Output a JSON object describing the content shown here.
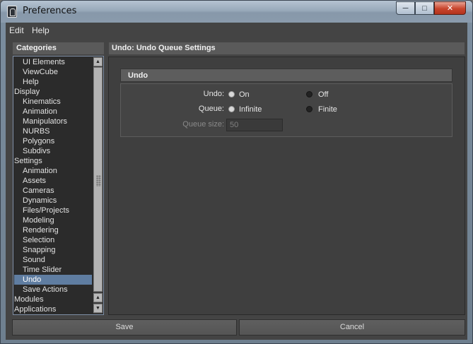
{
  "window": {
    "title": "Preferences",
    "icon": "maya-app-icon",
    "controls": {
      "minimize": "minimize-icon",
      "maximize": "maximize-icon",
      "close": "close-icon"
    }
  },
  "menubar": [
    {
      "label": "Edit"
    },
    {
      "label": "Help"
    }
  ],
  "categories": {
    "header": "Categories",
    "items": [
      {
        "label": "UI Elements",
        "indent": true
      },
      {
        "label": "ViewCube",
        "indent": true
      },
      {
        "label": "Help",
        "indent": true
      },
      {
        "label": "Display",
        "indent": false
      },
      {
        "label": "Kinematics",
        "indent": true
      },
      {
        "label": "Animation",
        "indent": true
      },
      {
        "label": "Manipulators",
        "indent": true
      },
      {
        "label": "NURBS",
        "indent": true
      },
      {
        "label": "Polygons",
        "indent": true
      },
      {
        "label": "Subdivs",
        "indent": true
      },
      {
        "label": "Settings",
        "indent": false
      },
      {
        "label": "Animation",
        "indent": true
      },
      {
        "label": "Assets",
        "indent": true
      },
      {
        "label": "Cameras",
        "indent": true
      },
      {
        "label": "Dynamics",
        "indent": true
      },
      {
        "label": "Files/Projects",
        "indent": true
      },
      {
        "label": "Modeling",
        "indent": true
      },
      {
        "label": "Rendering",
        "indent": true
      },
      {
        "label": "Selection",
        "indent": true
      },
      {
        "label": "Snapping",
        "indent": true
      },
      {
        "label": "Sound",
        "indent": true
      },
      {
        "label": "Time Slider",
        "indent": true
      },
      {
        "label": "Undo",
        "indent": true,
        "selected": true
      },
      {
        "label": "Save Actions",
        "indent": true
      },
      {
        "label": "Modules",
        "indent": false
      },
      {
        "label": "Applications",
        "indent": false
      }
    ]
  },
  "settings": {
    "header": "Undo: Undo Queue Settings",
    "frame_title": "Undo",
    "undo": {
      "label": "Undo:",
      "options": [
        {
          "label": "On",
          "selected": true
        },
        {
          "label": "Off",
          "selected": false
        }
      ]
    },
    "queue": {
      "label": "Queue:",
      "options": [
        {
          "label": "Infinite",
          "selected": true
        },
        {
          "label": "Finite",
          "selected": false
        }
      ]
    },
    "queue_size": {
      "label": "Queue size:",
      "value": "50",
      "enabled": false
    }
  },
  "buttons": {
    "save": "Save",
    "cancel": "Cancel"
  },
  "colors": {
    "selection": "#5f7da1",
    "panel": "#444444",
    "header": "#5a5a5a"
  }
}
